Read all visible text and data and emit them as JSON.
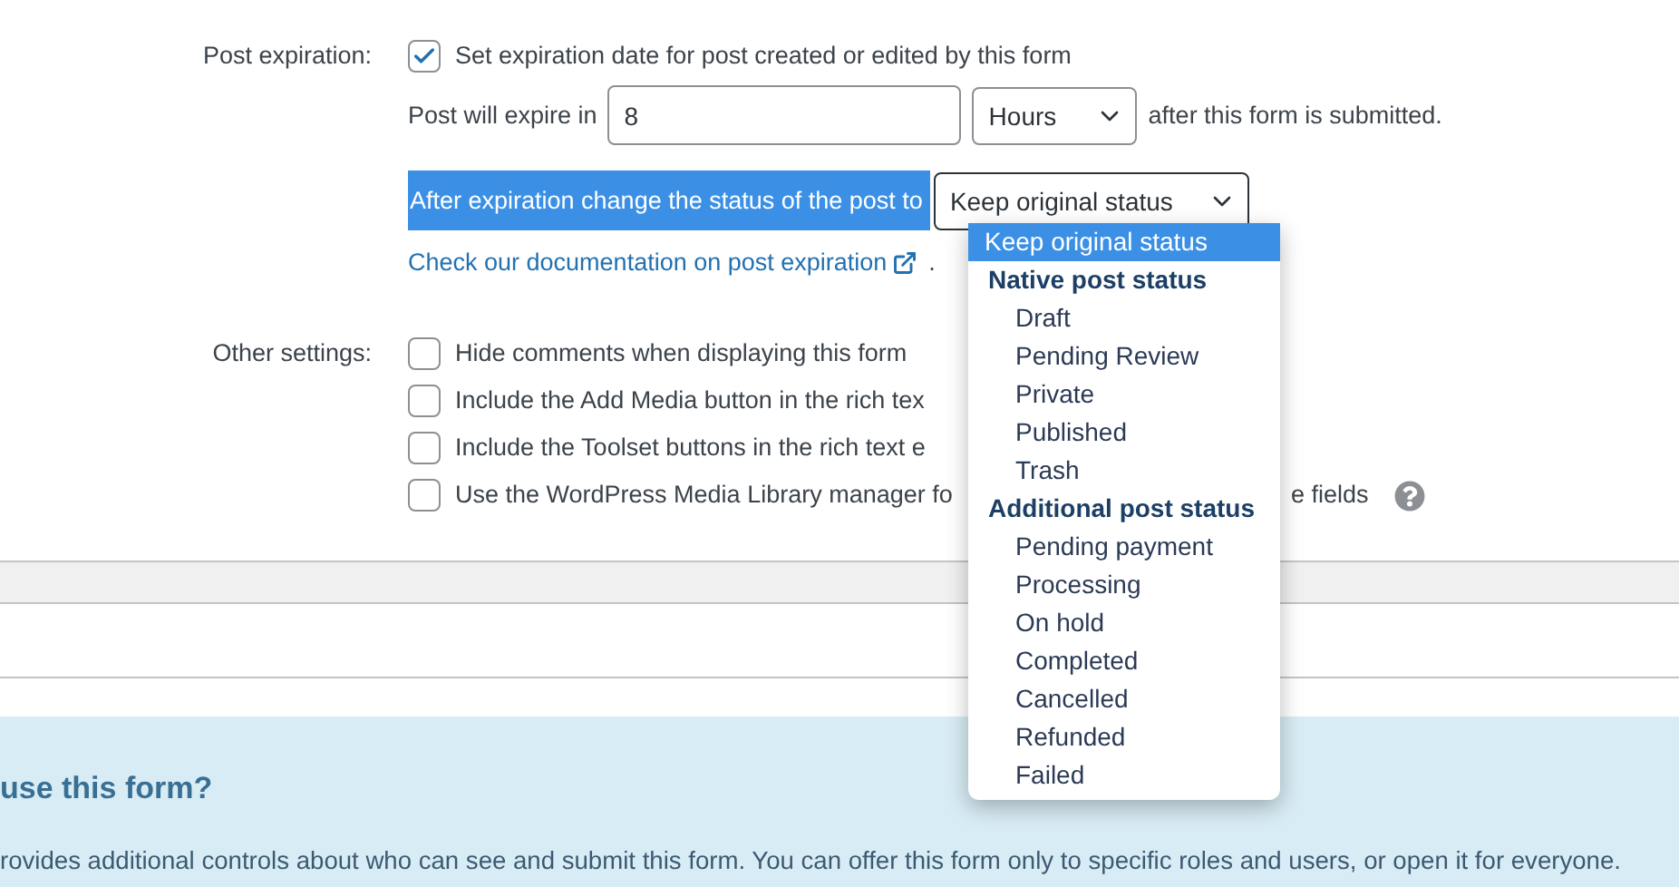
{
  "post_expiration": {
    "label": "Post expiration:",
    "enable": {
      "label": "Set expiration date for post created or edited by this form",
      "checked": true
    },
    "expire_prefix": "Post will expire in",
    "amount": "8",
    "unit": "Hours",
    "expire_suffix": "after this form is submitted.",
    "status_label": "After expiration change the status of the post to",
    "status_value": "Keep original status",
    "doc_link": "Check our documentation on post expiration",
    "doc_link_end": "."
  },
  "status_menu": {
    "items": [
      {
        "kind": "option",
        "label": "Keep original status",
        "selected": true
      },
      {
        "kind": "group",
        "label": "Native post status"
      },
      {
        "kind": "option",
        "label": "Draft",
        "selected": false
      },
      {
        "kind": "option",
        "label": "Pending Review",
        "selected": false
      },
      {
        "kind": "option",
        "label": "Private",
        "selected": false
      },
      {
        "kind": "option",
        "label": "Published",
        "selected": false
      },
      {
        "kind": "option",
        "label": "Trash",
        "selected": false
      },
      {
        "kind": "group",
        "label": "Additional post status"
      },
      {
        "kind": "option",
        "label": "Pending payment",
        "selected": false
      },
      {
        "kind": "option",
        "label": "Processing",
        "selected": false
      },
      {
        "kind": "option",
        "label": "On hold",
        "selected": false
      },
      {
        "kind": "option",
        "label": "Completed",
        "selected": false
      },
      {
        "kind": "option",
        "label": "Cancelled",
        "selected": false
      },
      {
        "kind": "option",
        "label": "Refunded",
        "selected": false
      },
      {
        "kind": "option",
        "label": "Failed",
        "selected": false
      }
    ]
  },
  "other_settings": {
    "label": "Other settings:",
    "options": [
      {
        "label": "Hide comments when displaying this form",
        "checked": false
      },
      {
        "label": "Include the Add Media button in the rich tex",
        "checked": false
      },
      {
        "label": "Include the Toolset buttons in the rich text e",
        "checked": false
      },
      {
        "label": "Use the WordPress Media Library manager fo",
        "tail": "e fields",
        "help": true,
        "checked": false
      }
    ]
  },
  "help_panel": {
    "heading": "use this form?",
    "text": "rovides additional controls about who can see and submit this form. You can offer this form only to specific roles and users, or open it for everyone."
  }
}
